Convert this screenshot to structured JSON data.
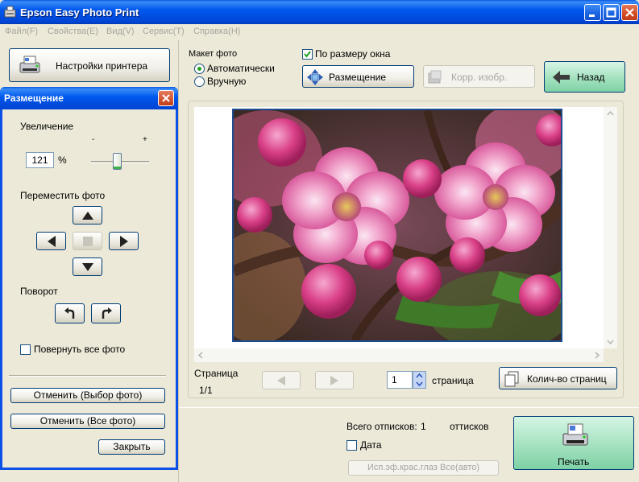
{
  "window": {
    "title": "Epson Easy Photo Print"
  },
  "menu": [
    "Файл(F)",
    "Свойства(E)",
    "Вид(V)",
    "Сервис(T)",
    "Справка(H)"
  ],
  "left": {
    "printer_settings": "Настройки принтера"
  },
  "dialog": {
    "title": "Размещение",
    "zoom_label": "Увеличение",
    "zoom_value": "121",
    "zoom_unit": "%",
    "zoom_minus": "-",
    "zoom_plus": "+",
    "zoom_level": 0.45,
    "move_label": "Переместить фото",
    "rotate_label": "Поворот",
    "rotate_all": "Повернуть все фото",
    "cancel_selected": "Отменить (Выбор фото)",
    "cancel_all": "Отменить (Все фото)",
    "close": "Закрыть"
  },
  "layout": {
    "label": "Макет фото",
    "auto": "Автоматически",
    "manual": "Вручную",
    "fit_window": "По размеру окна",
    "placement": "Размещение",
    "correct": "Корр. изобр.",
    "back": "Назад"
  },
  "paging": {
    "page_label": "Страница",
    "page_value": "1/1",
    "page_count_value": "1",
    "page_unit": "страница",
    "page_count_button": "Колич-во страниц"
  },
  "status": {
    "total_label": "Всего отпиcков:",
    "total_value": "1",
    "total_unit": "оттисков",
    "date_label": "Дата",
    "red_eye": "Исп.эф.крас.глаз Все(авто)",
    "print": "Печать"
  },
  "colors": {
    "titlebar": "#0058ee",
    "accent_green": "#9fe0bc",
    "face": "#ece9d8"
  }
}
